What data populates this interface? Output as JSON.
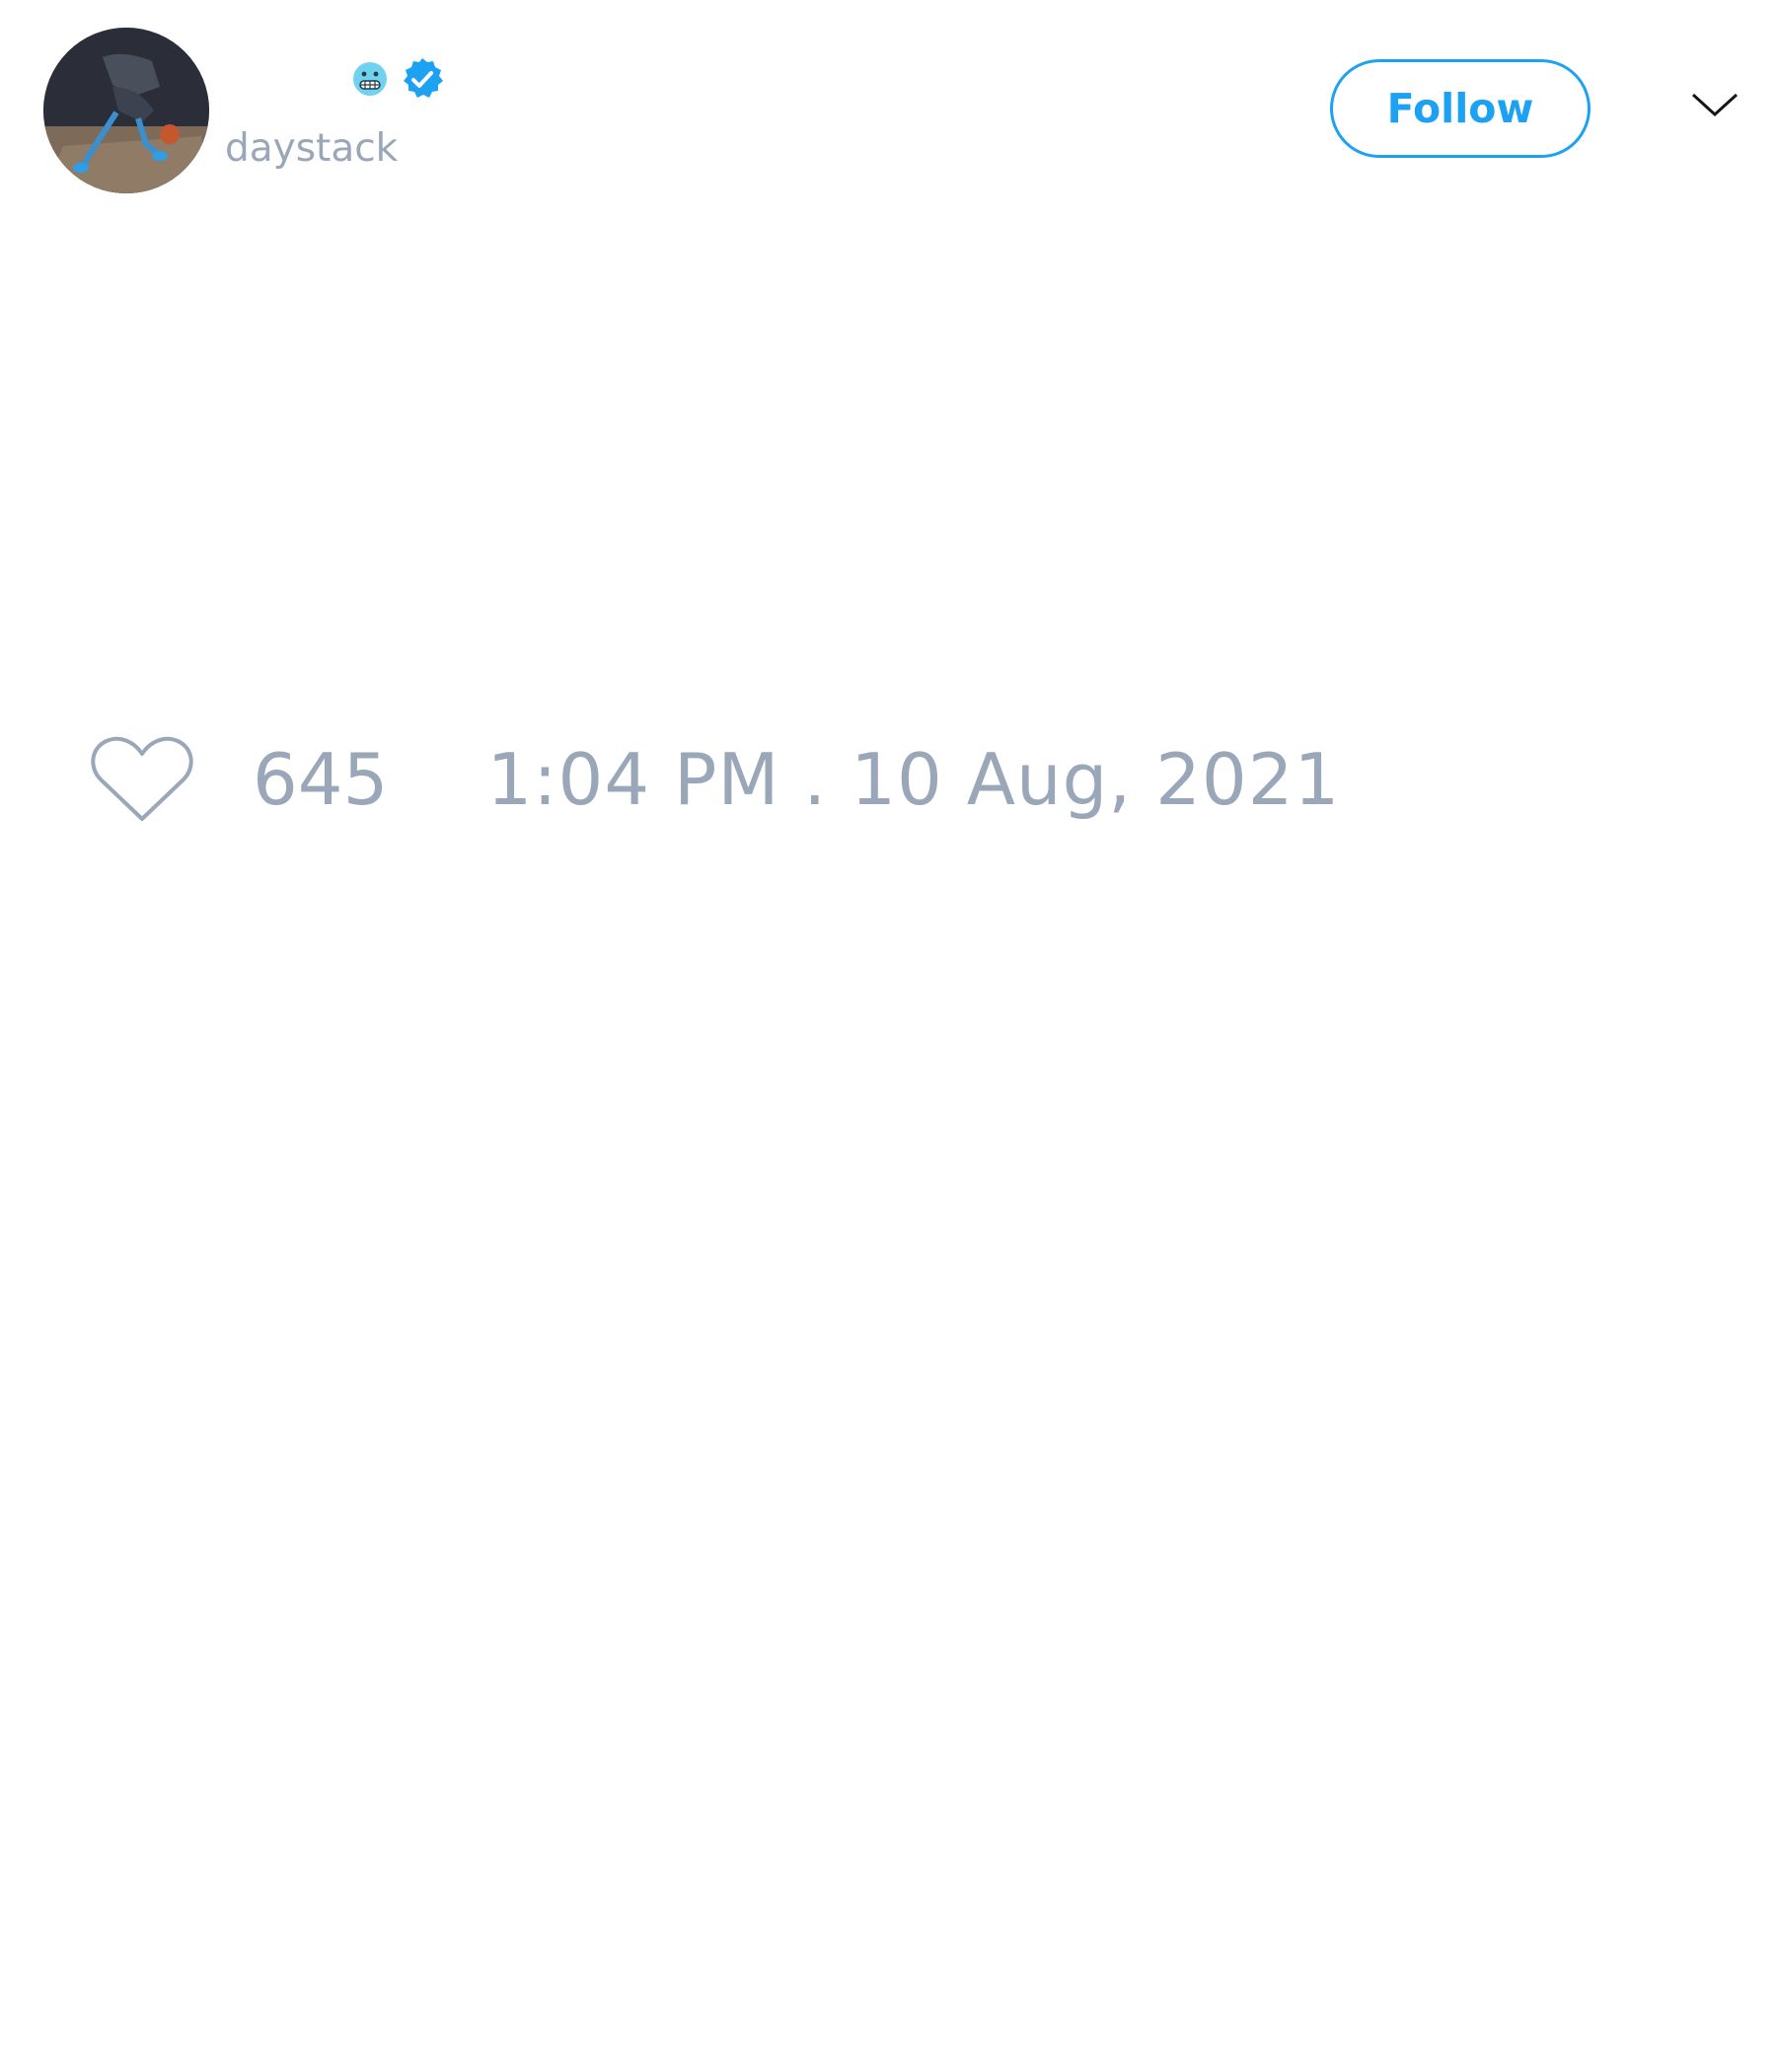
{
  "header": {
    "display_name": "",
    "handle": "daystack",
    "follow_label": "Follow",
    "badges": [
      "grimacing-face-emoji-icon",
      "verified-badge-icon"
    ]
  },
  "tweet": {
    "like_count": "645",
    "timestamp": "1:04 PM . 10 Aug, 2021"
  },
  "colors": {
    "accent": "#1da1f2",
    "muted_text": "#9aa7b8",
    "background": "#ffffff"
  }
}
